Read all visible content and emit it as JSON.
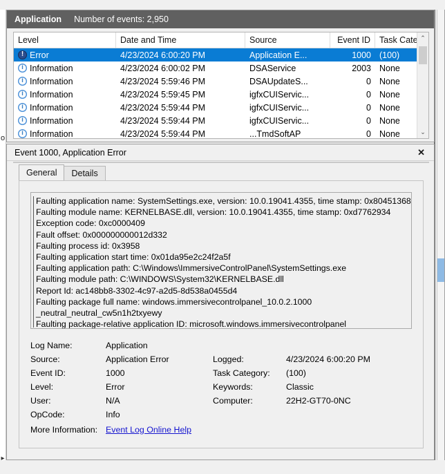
{
  "window": {
    "list_header": {
      "log_name": "Application",
      "event_count_label": "Number of events: 2,950"
    }
  },
  "grid": {
    "columns": [
      {
        "label": "Level",
        "align": "left"
      },
      {
        "label": "Date and Time",
        "align": "left"
      },
      {
        "label": "Source",
        "align": "left"
      },
      {
        "label": "Event ID",
        "align": "right"
      },
      {
        "label": "Task Category",
        "align": "left"
      }
    ],
    "rows": [
      {
        "icon": "error-icon",
        "level": "Error",
        "date": "4/23/2024 6:00:20 PM",
        "source": "Application E...",
        "event_id": "1000",
        "category": "(100)",
        "selected": true
      },
      {
        "icon": "info-icon",
        "level": "Information",
        "date": "4/23/2024 6:00:02 PM",
        "source": "DSAService",
        "event_id": "2003",
        "category": "None",
        "selected": false
      },
      {
        "icon": "info-icon",
        "level": "Information",
        "date": "4/23/2024 5:59:46 PM",
        "source": "DSAUpdateS...",
        "event_id": "0",
        "category": "None",
        "selected": false
      },
      {
        "icon": "info-icon",
        "level": "Information",
        "date": "4/23/2024 5:59:45 PM",
        "source": "igfxCUIServic...",
        "event_id": "0",
        "category": "None",
        "selected": false
      },
      {
        "icon": "info-icon",
        "level": "Information",
        "date": "4/23/2024 5:59:44 PM",
        "source": "igfxCUIServic...",
        "event_id": "0",
        "category": "None",
        "selected": false
      },
      {
        "icon": "info-icon",
        "level": "Information",
        "date": "4/23/2024 5:59:44 PM",
        "source": "igfxCUIServic...",
        "event_id": "0",
        "category": "None",
        "selected": false
      },
      {
        "icon": "info-icon",
        "level": "Information",
        "date": "4/23/2024 5:59:44 PM",
        "source": "...TmdSoftAP",
        "event_id": "0",
        "category": "None",
        "selected": false
      }
    ],
    "scrollbar": {
      "up_arrow": "⌃",
      "down_arrow": "⌄"
    }
  },
  "detail": {
    "title": "Event 1000, Application Error",
    "close_label": "✕",
    "tabs": [
      {
        "label": "General",
        "active": true
      },
      {
        "label": "Details",
        "active": false
      }
    ],
    "description_lines": [
      "Faulting application name: SystemSettings.exe, version: 10.0.19041.4355, time stamp: 0x80451368",
      "Faulting module name: KERNELBASE.dll, version: 10.0.19041.4355, time stamp: 0xd7762934",
      "Exception code: 0xc0000409",
      "Fault offset: 0x000000000012d332",
      "Faulting process id: 0x3958",
      "Faulting application start time: 0x01da95e2c24f2a5f",
      "Faulting application path: C:\\Windows\\ImmersiveControlPanel\\SystemSettings.exe",
      "Faulting module path: C:\\WINDOWS\\System32\\KERNELBASE.dll",
      "Report Id: ac148bb8-3302-4c97-a2d5-8d538a0455d4",
      "Faulting package full name: windows.immersivecontrolpanel_10.0.2.1000",
      "_neutral_neutral_cw5n1h2txyewy",
      "Faulting package-relative application ID: microsoft.windows.immersivecontrolpanel"
    ],
    "fields": {
      "log_name_label": "Log Name:",
      "log_name_value": "Application",
      "source_label": "Source:",
      "source_value": "Application Error",
      "logged_label": "Logged:",
      "logged_value": "4/23/2024 6:00:20 PM",
      "event_id_label": "Event ID:",
      "event_id_value": "1000",
      "task_category_label": "Task Category:",
      "task_category_value": "(100)",
      "level_label": "Level:",
      "level_value": "Error",
      "keywords_label": "Keywords:",
      "keywords_value": "Classic",
      "user_label": "User:",
      "user_value": "N/A",
      "computer_label": "Computer:",
      "computer_value": "22H2-GT70-0NC",
      "opcode_label": "OpCode:",
      "opcode_value": "Info",
      "more_info_label": "More Information:",
      "more_info_link": "Event Log Online Help"
    }
  },
  "edges": {
    "left_glyph": "o",
    "left_arrow": "▸"
  },
  "colors": {
    "header_bg": "#606060",
    "selection": "#0a7cd4",
    "link": "#1414cf",
    "error_icon": "#2b4d8e",
    "info_icon": "#4a90d9",
    "accent_right": "#8ebae4"
  }
}
